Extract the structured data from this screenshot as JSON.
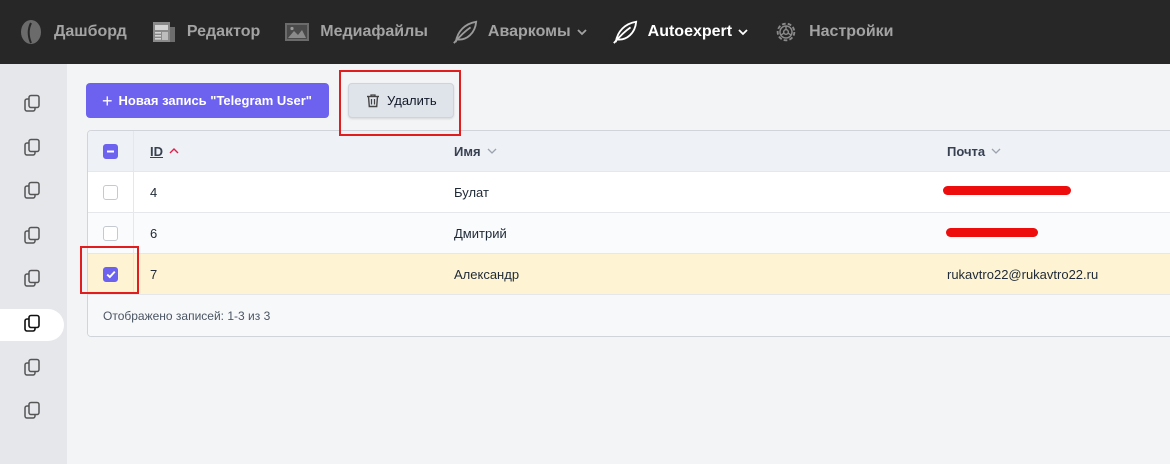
{
  "nav": {
    "items": [
      {
        "label": "Дашборд",
        "icon": "leaf-logo-icon",
        "active": false
      },
      {
        "label": "Редактор",
        "icon": "newspaper-icon",
        "active": false
      },
      {
        "label": "Медиафайлы",
        "icon": "image-icon",
        "active": false
      },
      {
        "label": "Аваркомы",
        "icon": "leaf-icon",
        "active": false,
        "dropdown": true
      },
      {
        "label": "Autoexpert",
        "icon": "leaf-icon",
        "active": true,
        "dropdown": true
      },
      {
        "label": "Настройки",
        "icon": "gear-icon",
        "active": false
      }
    ]
  },
  "sidebar": {
    "items": [
      {
        "icon": "copy-icon",
        "active": false
      },
      {
        "icon": "copy-icon",
        "active": false
      },
      {
        "icon": "copy-icon",
        "active": false
      },
      {
        "icon": "copy-icon",
        "active": false
      },
      {
        "icon": "copy-icon",
        "active": false
      },
      {
        "icon": "copy-icon",
        "active": true
      },
      {
        "icon": "copy-icon",
        "active": false
      },
      {
        "icon": "copy-icon",
        "active": false
      }
    ]
  },
  "toolbar": {
    "new_label": "Новая запись \"Telegram User\"",
    "delete_label": "Удалить"
  },
  "table": {
    "columns": {
      "id": "ID",
      "name": "Имя",
      "email": "Почта"
    },
    "sort": {
      "column": "ID",
      "direction": "asc"
    },
    "header_checkbox": "indeterminate",
    "rows": [
      {
        "id": "4",
        "name": "Булат",
        "email": "",
        "email_redacted": true,
        "checked": false
      },
      {
        "id": "6",
        "name": "Дмитрий",
        "email": "",
        "email_redacted": true,
        "checked": false
      },
      {
        "id": "7",
        "name": "Александр",
        "email": "rukavtro22@rukavtro22.ru",
        "email_redacted": false,
        "checked": true
      }
    ],
    "footer": "Отображено записей: 1-3 из 3"
  },
  "colors": {
    "topbar": "#272727",
    "accent": "#6d62f0",
    "selected_row": "#fef4d3",
    "annotation": "#e11d1d"
  }
}
